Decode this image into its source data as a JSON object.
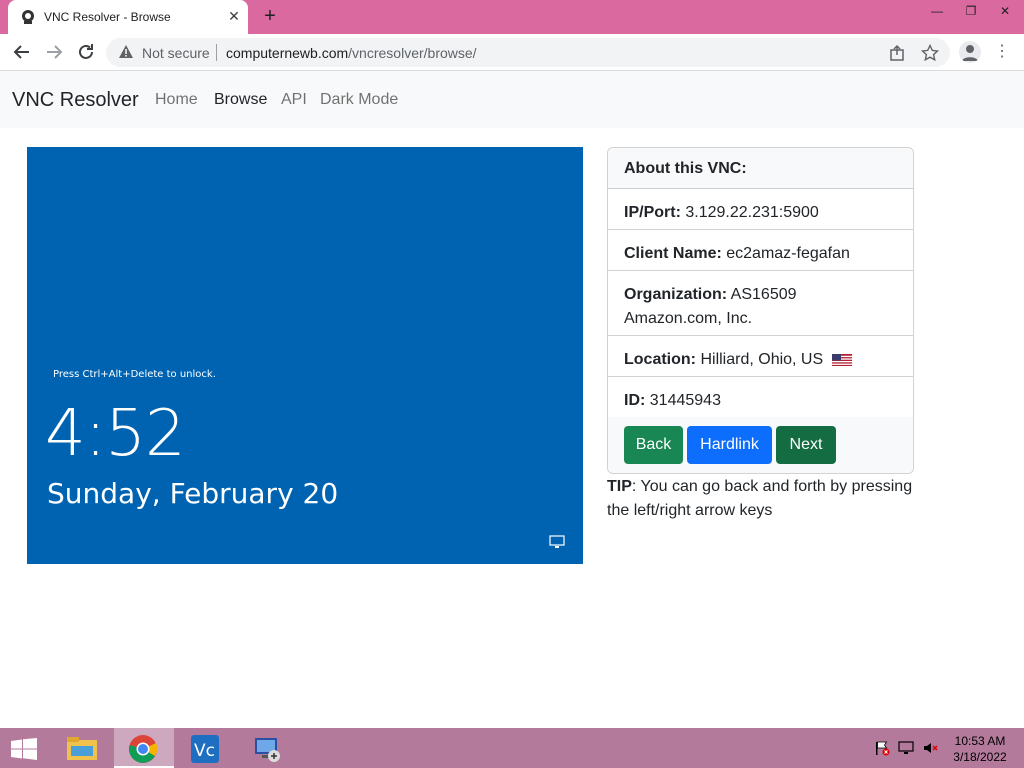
{
  "browser": {
    "tab_title": "VNC Resolver - Browse",
    "security_label": "Not secure",
    "url_host": "computernewb.com",
    "url_path": "/vncresolver/browse/"
  },
  "navbar": {
    "brand": "VNC Resolver",
    "links": [
      "Home",
      "Browse",
      "API",
      "Dark Mode"
    ],
    "active": "Browse"
  },
  "screenshot": {
    "unlock_hint": "Press Ctrl+Alt+Delete to unlock.",
    "time": "4:52",
    "date": "Sunday, February 20",
    "background_color": "#0063b1"
  },
  "card": {
    "header": "About this VNC:",
    "rows": [
      {
        "label": "IP/Port:",
        "value": "3.129.22.231:5900"
      },
      {
        "label": "Client Name:",
        "value": "ec2amaz-fegafan"
      },
      {
        "label": "Organization:",
        "value": "AS16509 Amazon.com, Inc."
      },
      {
        "label": "Location:",
        "value": "Hilliard, Ohio, US",
        "icon": "us-flag-icon"
      },
      {
        "label": "ID:",
        "value": "31445943"
      }
    ],
    "buttons": {
      "back": "Back",
      "hardlink": "Hardlink",
      "next": "Next"
    }
  },
  "tip": {
    "label": "TIP",
    "text": ": You can go back and forth by pressing the left/right arrow keys"
  },
  "taskbar": {
    "apps": [
      "file-explorer-icon",
      "chrome-icon",
      "vnc-viewer-icon",
      "remote-desktop-icon"
    ],
    "time": "10:53 AM",
    "date": "3/18/2022"
  },
  "colors": {
    "titlebar": "#d9699f",
    "taskbar": "#b47a9c",
    "btn_back": "#198754",
    "btn_hardlink": "#0d6efd",
    "btn_next": "#146c43"
  }
}
